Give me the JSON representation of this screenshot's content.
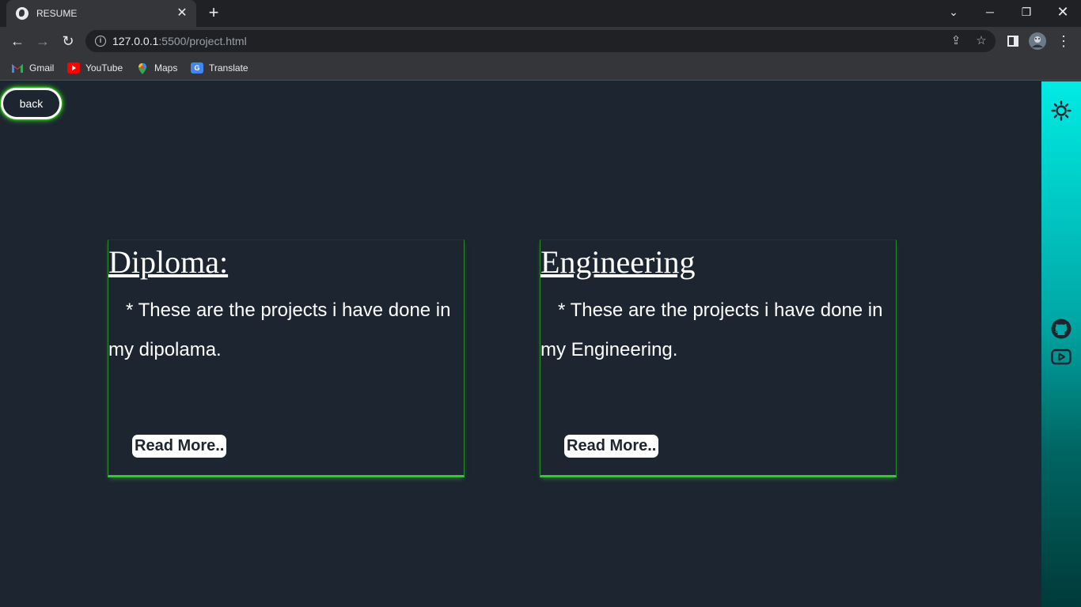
{
  "browser": {
    "tab_title": "RESUME",
    "url_host": "127.0.0.1",
    "url_path": ":5500/project.html",
    "bookmarks": [
      "Gmail",
      "YouTube",
      "Maps",
      "Translate"
    ]
  },
  "page": {
    "back_label": "back",
    "cards": [
      {
        "title": "Diploma:",
        "description": "* These are the projects i have done in my dipolama.",
        "button": "Read More.."
      },
      {
        "title": "Engineering",
        "description": "* These are the projects i have done in my Engineering.",
        "button": "Read More.."
      }
    ]
  },
  "sidebar": {
    "icons": [
      "sun-icon",
      "github-icon",
      "youtube-icon"
    ]
  },
  "colors": {
    "page_bg": "#1c2530",
    "glow": "#39ff14",
    "card_border": "#2ecc2e",
    "sidebar_top": "#00ebe4",
    "sidebar_bottom": "#003a39"
  }
}
